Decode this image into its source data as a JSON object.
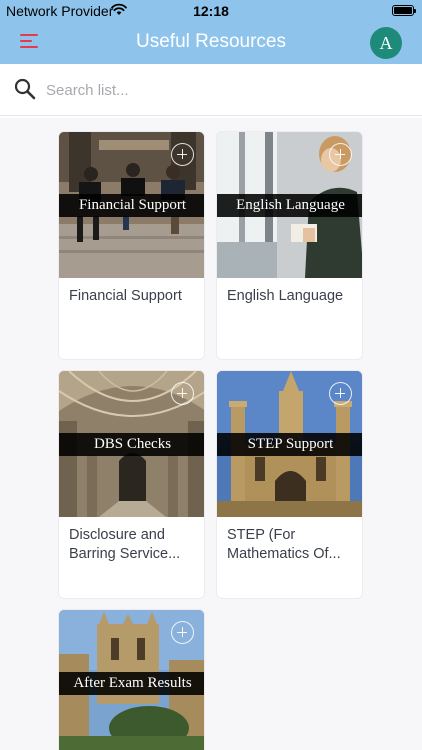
{
  "status_bar": {
    "carrier": "Network Provider",
    "time": "12:18"
  },
  "header": {
    "title": "Useful Resources",
    "avatar_initial": "A"
  },
  "search": {
    "placeholder": "Search list..."
  },
  "cards": [
    {
      "banner": "Financial Support",
      "title_line1": "Financial Support",
      "title_line2": ""
    },
    {
      "banner": "English Language",
      "title_line1": "English Language",
      "title_line2": ""
    },
    {
      "banner": "DBS Checks",
      "title_line1": "Disclosure and",
      "title_line2": "Barring Service..."
    },
    {
      "banner": "STEP Support",
      "title_line1": "STEP (For",
      "title_line2": "Mathematics Of..."
    },
    {
      "banner": "After Exam Results",
      "title_line1": "",
      "title_line2": ""
    }
  ],
  "colors": {
    "navbar": "#8ec4ec",
    "menu_icon": "#e53b4b",
    "avatar": "#1e8a79"
  }
}
